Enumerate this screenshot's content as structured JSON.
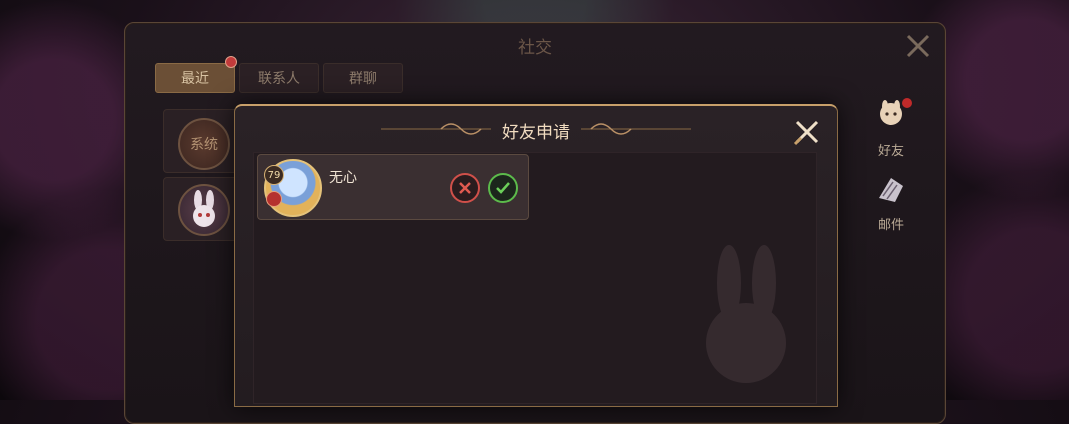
{
  "social_panel": {
    "title": "社交",
    "tabs": [
      {
        "label": "最近",
        "active": true
      },
      {
        "label": "联系人",
        "active": false
      },
      {
        "label": "群聊",
        "active": false
      }
    ],
    "list": [
      {
        "avatar_label": "系统"
      }
    ],
    "side_buttons": [
      {
        "label": "好友",
        "icon": "friend-icon",
        "has_notification": true
      },
      {
        "label": "邮件",
        "icon": "mail-icon",
        "has_notification": false
      }
    ]
  },
  "modal": {
    "title": "好友申请",
    "requests": [
      {
        "name": "无心",
        "level": "79",
        "gender_icon": "female-icon"
      }
    ]
  },
  "colors": {
    "accent_gold": "#c8a06a",
    "reject_red": "#d0504a",
    "accept_green": "#5cbb4b",
    "notification_red": "#c02a2a"
  }
}
